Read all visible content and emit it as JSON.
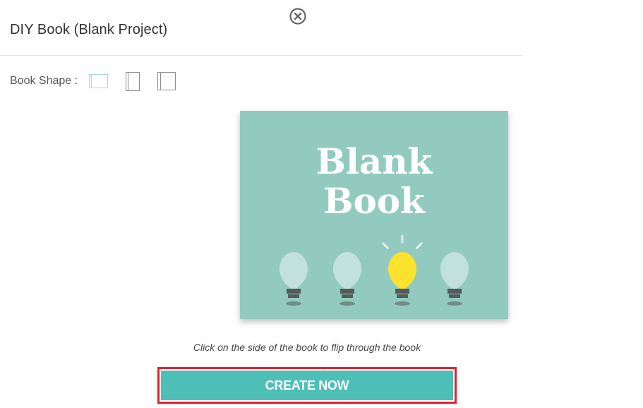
{
  "dialog": {
    "title": "DIY Book (Blank Project)",
    "close_icon": "close-circle-icon"
  },
  "book_shape": {
    "label": "Book Shape :",
    "options": [
      {
        "name": "landscape",
        "icon": "landscape-book-icon",
        "selected": true
      },
      {
        "name": "portrait",
        "icon": "portrait-book-icon",
        "selected": false
      },
      {
        "name": "square",
        "icon": "square-book-icon",
        "selected": false
      }
    ]
  },
  "preview": {
    "title_line1": "Blank",
    "title_line2": "Book",
    "background_color": "#93cac0",
    "bulb_highlight_color": "#fbe22c"
  },
  "hint": "Click on the side of the book to flip through the book",
  "create_button": {
    "label": "CREATE NOW",
    "color": "#4dbfb7",
    "highlight_border_color": "#e3202e"
  }
}
